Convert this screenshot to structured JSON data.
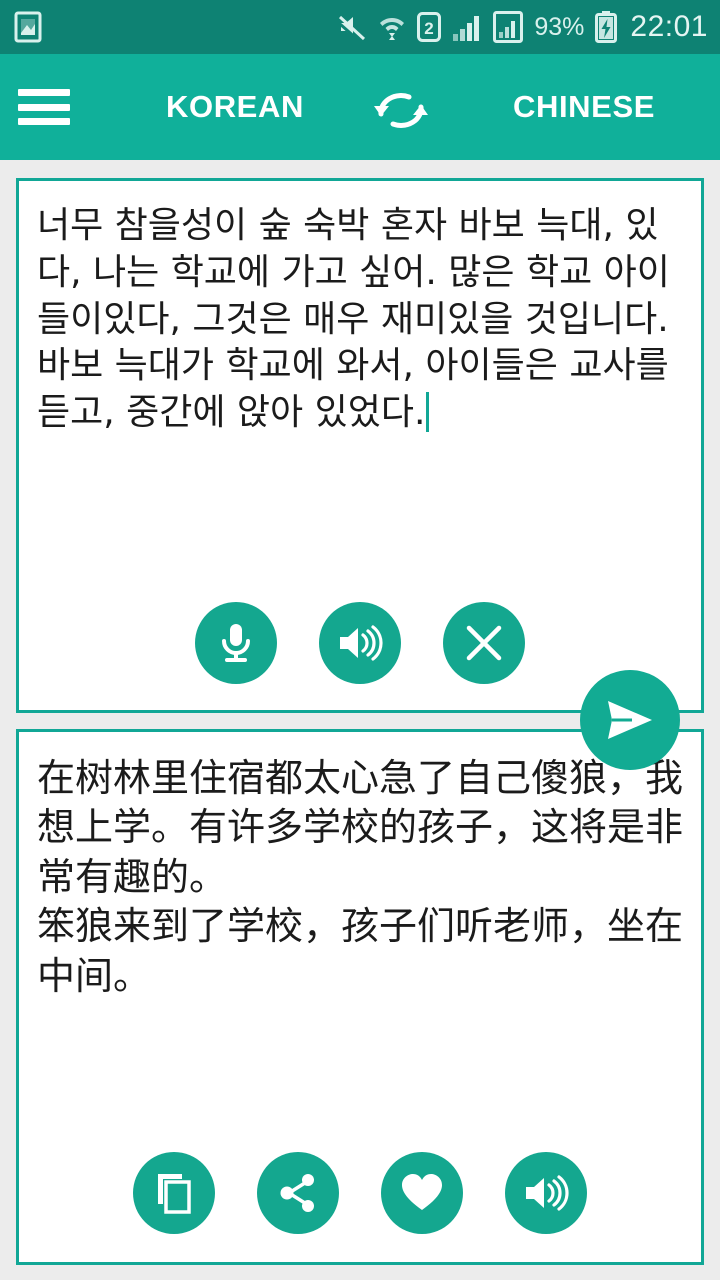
{
  "status_bar": {
    "left_icons": [
      {
        "name": "photo-icon",
        "label": "image"
      }
    ],
    "right_icons": [
      {
        "name": "mute-icon",
        "label": "silent mode"
      },
      {
        "name": "wifi-icon",
        "label": "wifi"
      },
      {
        "name": "sim2-icon",
        "label": "2"
      },
      {
        "name": "signal-1-icon",
        "label": "signal bars"
      },
      {
        "name": "signal-2-icon",
        "label": "signal bars"
      }
    ],
    "battery_percent": "93%",
    "battery_state": "charging",
    "clock": "22:01",
    "background_color": "#0e8273",
    "text_color": "#ddf3ef"
  },
  "app_bar": {
    "menu_icon": "hamburger-menu-icon",
    "source_language": "KOREAN",
    "swap_icon": "swap-languages-icon",
    "target_language": "CHINESE",
    "background_color": "#10b09a",
    "text_color": "#ffffff"
  },
  "source_panel": {
    "text": "너무 참을성이 숲 숙박 혼자 바보 늑대, 있다, 나는 학교에 가고 싶어. 많은 학교 아이들이있다, 그것은 매우 재미있을 것입니다.\n바보 늑대가 학교에 와서, 아이들은 교사를 듣고, 중간에 앉아 있었다.",
    "caret_visible": true,
    "border_color": "#11a796",
    "buttons": [
      {
        "name": "microphone-button",
        "icon": "microphone-icon",
        "label": "Voice input"
      },
      {
        "name": "speak-source-button",
        "icon": "speaker-icon",
        "label": "Speak"
      },
      {
        "name": "clear-text-button",
        "icon": "close-icon",
        "label": "Clear"
      }
    ]
  },
  "send_button": {
    "name": "send-button",
    "icon": "send-paper-plane-icon",
    "label": "Translate",
    "color": "#12ab93"
  },
  "target_panel": {
    "text": "在树林里住宿都太心急了自己傻狼，我想上学。有许多学校的孩子，这将是非常有趣的。\n笨狼来到了学校，孩子们听老师，坐在中间。",
    "border_color": "#11a796",
    "buttons": [
      {
        "name": "copy-button",
        "icon": "copy-icon",
        "label": "Copy"
      },
      {
        "name": "share-button",
        "icon": "share-icon",
        "label": "Share"
      },
      {
        "name": "favorite-button",
        "icon": "heart-icon",
        "label": "Favorite"
      },
      {
        "name": "speak-target-button",
        "icon": "speaker-icon",
        "label": "Speak"
      }
    ]
  },
  "theme": {
    "accent": "#14a78f",
    "page_background": "#ececec",
    "panel_background": "#ffffff"
  }
}
